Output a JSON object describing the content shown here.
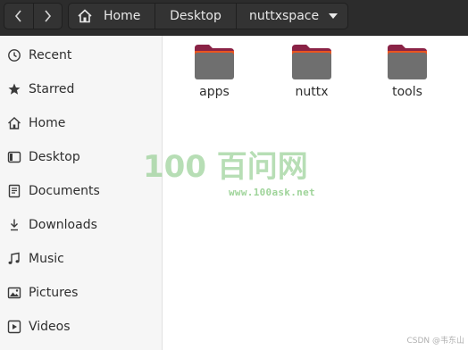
{
  "header": {
    "back_icon": "chevron-left-icon",
    "forward_icon": "chevron-right-icon",
    "breadcrumbs": [
      {
        "label": "Home",
        "icon": "home-icon"
      },
      {
        "label": "Desktop"
      },
      {
        "label": "nuttxspace",
        "icon": "chevron-down-icon"
      }
    ]
  },
  "sidebar": {
    "items": [
      {
        "label": "Recent",
        "icon": "clock-icon"
      },
      {
        "label": "Starred",
        "icon": "star-icon"
      },
      {
        "label": "Home",
        "icon": "home-icon"
      },
      {
        "label": "Desktop",
        "icon": "desktop-icon"
      },
      {
        "label": "Documents",
        "icon": "document-icon"
      },
      {
        "label": "Downloads",
        "icon": "download-icon"
      },
      {
        "label": "Music",
        "icon": "music-icon"
      },
      {
        "label": "Pictures",
        "icon": "picture-icon"
      },
      {
        "label": "Videos",
        "icon": "video-icon"
      }
    ]
  },
  "files": [
    {
      "name": "apps",
      "icon": "folder-icon"
    },
    {
      "name": "nuttx",
      "icon": "folder-icon"
    },
    {
      "name": "tools",
      "icon": "folder-icon"
    }
  ],
  "watermark": {
    "logo": "100 百问网",
    "url": "www.100ask.net",
    "credit": "CSDN @韦东山"
  },
  "colors": {
    "header_bg": "#2c2c2c",
    "sidebar_bg": "#f6f6f6",
    "folder_body": "#6f6f6f",
    "folder_tab": "#8a2346",
    "folder_accent": "#e95420",
    "watermark_green": "#7dc47a"
  }
}
